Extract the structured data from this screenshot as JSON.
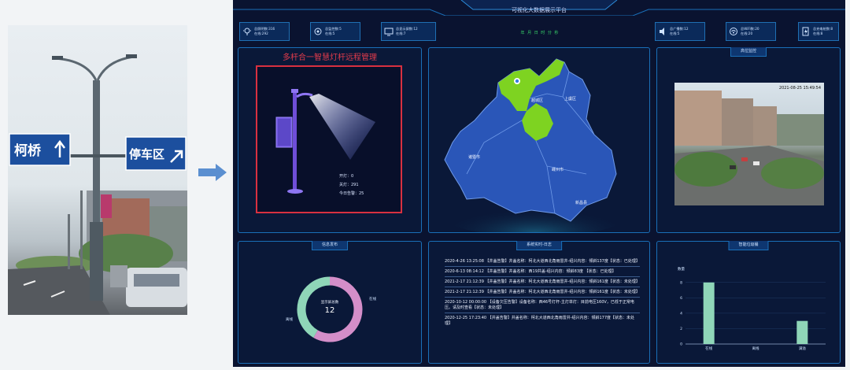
{
  "street_photo": {
    "sign_left": "柯桥",
    "sign_right": "停车区"
  },
  "dashboard": {
    "title": "可视化大数据展示平台",
    "clock": "年 月 日 时 分 秒",
    "stats_left": [
      {
        "icon": "lamp-icon",
        "line1": "总照明数:316",
        "line2": "在线:292"
      },
      {
        "icon": "wifi-icon",
        "line1": "总监控数:5",
        "line2": "在线:5"
      },
      {
        "icon": "monitor-icon",
        "line1": "总显示屏数:12",
        "line2": "在线:7"
      }
    ],
    "stats_right": [
      {
        "icon": "speaker-icon",
        "line1": "总广播数:12",
        "line2": "在线:5"
      },
      {
        "icon": "wifi-ap-icon",
        "line1": "总WiFi数:20",
        "line2": "在线:20"
      },
      {
        "icon": "charger-icon",
        "line1": "总充电桩数:8",
        "line2": "在线:8"
      }
    ],
    "pole_panel": {
      "title": "多杆合一智慧灯杆远程管理",
      "on": "开灯：0",
      "off": "关灯：291",
      "alarm": "今日告警：25"
    },
    "map_panel": {
      "districts": [
        "越城区",
        "上虞区",
        "诸暨市",
        "嵊州市",
        "新昌县"
      ]
    },
    "camera_panel": {
      "title": "高位监控",
      "timestamp": "2021-08-25 15:49:54"
    },
    "donut_panel": {
      "title": "信息发布",
      "center_label": "显示屏总数",
      "center_value": "12",
      "label_on": "在线",
      "label_off": "离线"
    },
    "log_panel": {
      "title": "系统实时-日志",
      "entries": [
        "2020-4-26 13:25:08   【井盖告警】井盖名称：柯北大道西北角雨雷井-绍兴内容：倾斜137度【状态：已处理】",
        "2020-6-13 08:14:12   【井盖告警】井盖名称：西19井盖-绍兴内容：倾斜83度 【状态：已处理】",
        "2021-2-17 21:12:39   【井盖告警】井盖名称：柯北大道西北角雨雷井-绍兴内容：倾斜161度【状态：未处理】",
        "2021-2-17 21:12:39   【井盖告警】井盖名称：柯北大道西北角雨雷井-绍兴内容：倾斜161度【状态：未处理】",
        "2020-10-12 00:00:00   【设备欠压告警】设备名称：西46号灯杆-主灯单灯：目前电压160V，已低于正常电压。请及时查看【状态：未处理】",
        "2020-12-25 17:23:40   【井盖告警】井盖名称：柯北大道西北角雨雷井-绍兴内容：倾斜177度【状态：未处理】"
      ]
    },
    "bar_panel": {
      "title": "智能垃圾桶"
    }
  },
  "chart_data": [
    {
      "type": "pie",
      "title": "信息发布",
      "categories": [
        "在线",
        "离线"
      ],
      "values": [
        7,
        5
      ],
      "colors": [
        "#d48ec9",
        "#8fd6b8"
      ]
    },
    {
      "type": "bar",
      "title": "智能垃圾桶",
      "ylabel": "数量",
      "categories": [
        "在线",
        "离线",
        "满溢"
      ],
      "values": [
        8,
        0,
        3
      ],
      "ylim": [
        0,
        9
      ],
      "yticks": [
        0,
        2,
        4,
        6,
        8
      ],
      "color": "#8fd6b8"
    }
  ]
}
